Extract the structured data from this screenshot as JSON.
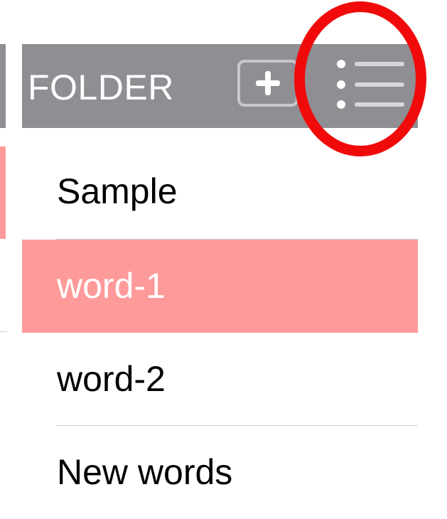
{
  "header": {
    "title": "FOLDER",
    "add_icon": "plus-icon",
    "menu_icon": "list-icon"
  },
  "folders": [
    {
      "label": "Sample",
      "selected": false
    },
    {
      "label": "word-1",
      "selected": true
    },
    {
      "label": "word-2",
      "selected": false
    },
    {
      "label": "New words",
      "selected": false
    }
  ],
  "colors": {
    "header_bg": "#8e8e93",
    "selected_bg": "#ff9a9a",
    "highlight": "#f00a0a"
  }
}
